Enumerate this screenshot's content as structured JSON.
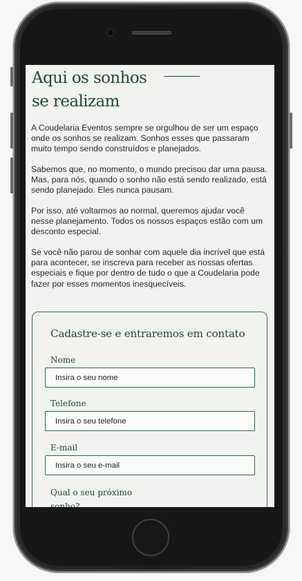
{
  "hero": {
    "title_line1": "Aqui os sonhos",
    "title_line2": "se realizam"
  },
  "paragraphs": [
    "A Coudelaria Eventos sempre se orgulhou de ser um espaço onde os sonhos se realizam. Sonhos esses que passaram muito tempo sendo construídos e planejados.",
    "Sabemos que, no momento, o mundo precisou dar uma pausa. Mas, para nós, quando o sonho não está sendo realizado, está sendo planejado. Eles nunca pausam.",
    "Por isso, até voltarmos ao normal, queremos ajudar você nesse planejamento. Todos os nossos espaços estão com um desconto especial.",
    "Se você não parou de sonhar com aquele dia incrível que está para acontecer, se inscreva para receber as nossas ofertas especiais e fique por dentro de tudo o que a Coudelaria pode fazer por esses momentos inesquecíveis."
  ],
  "form": {
    "title": "Cadastre-se e entraremos em contato",
    "fields": [
      {
        "label": "Nome",
        "placeholder": "Insira o seu nome"
      },
      {
        "label": "Telefone",
        "placeholder": "Insira o seu telefone"
      },
      {
        "label": "E-mail",
        "placeholder": "Insira o seu e-mail"
      }
    ],
    "dream_label": "Qual o seu próximo sonho?"
  },
  "colors": {
    "brand_green": "#1f4e2c",
    "border_green": "#2e6b3c",
    "screen_background": "#f2f2f1"
  }
}
